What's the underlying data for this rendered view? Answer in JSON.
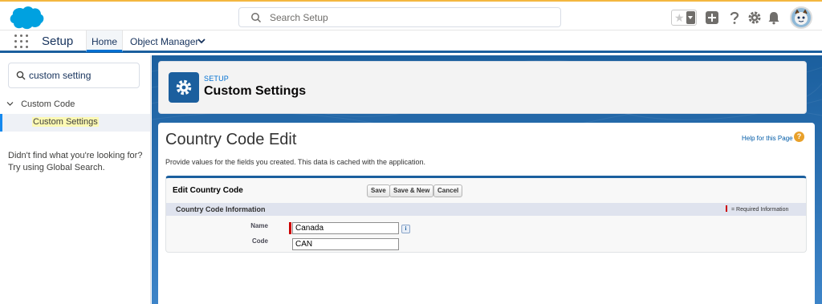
{
  "global_search": {
    "placeholder": "Search Setup"
  },
  "icons": {
    "logo": "salesforce-cloud-logo",
    "favorites": "star-icon",
    "add": "plus-icon",
    "help": "question-icon",
    "settings": "gear-icon",
    "notifications": "bell-icon",
    "avatar": "astro-avatar"
  },
  "nav": {
    "app_name": "Setup",
    "tabs": [
      {
        "label": "Home",
        "active": true
      },
      {
        "label": "Object Manager",
        "active": false
      }
    ]
  },
  "sidebar": {
    "quick_find_value": "custom setting",
    "tree": {
      "parent": "Custom Code",
      "child": "Custom Settings"
    },
    "help_text": "Didn't find what you're looking for? Try using Global Search."
  },
  "header": {
    "kicker": "SETUP",
    "title": "Custom Settings"
  },
  "page": {
    "title": "Country Code Edit",
    "help_link": "Help for this Page",
    "description": "Provide values for the fields you created. This data is cached with the application.",
    "edit_block": {
      "title": "Edit Country Code",
      "buttons": {
        "save": "Save",
        "save_new": "Save & New",
        "cancel": "Cancel"
      },
      "section_title": "Country Code Information",
      "required_legend": "= Required Information",
      "fields": [
        {
          "label": "Name",
          "value": "Canada",
          "required": true
        },
        {
          "label": "Code",
          "value": "CAN",
          "required": false
        }
      ]
    }
  },
  "colors": {
    "brand_blue": "#1b5f9e",
    "link_blue": "#0070d2",
    "required_red": "#cc0000",
    "help_orange": "#e8a02a"
  }
}
